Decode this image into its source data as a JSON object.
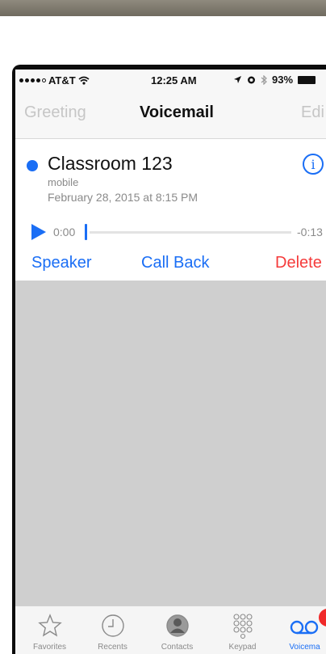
{
  "status": {
    "carrier": "AT&T",
    "time": "12:25 AM",
    "battery": "93%"
  },
  "nav": {
    "left": "Greeting",
    "title": "Voicemail",
    "right": "Edi"
  },
  "voicemail": {
    "caller": "Classroom 123",
    "type": "mobile",
    "date": "February 28, 2015 at 8:15 PM",
    "elapsed": "0:00",
    "remaining": "-0:13",
    "actions": {
      "speaker": "Speaker",
      "callback": "Call Back",
      "delete": "Delete"
    }
  },
  "tabs": [
    {
      "label": "Favorites",
      "icon": "star-icon"
    },
    {
      "label": "Recents",
      "icon": "clock-icon"
    },
    {
      "label": "Contacts",
      "icon": "contact-icon"
    },
    {
      "label": "Keypad",
      "icon": "keypad-icon"
    },
    {
      "label": "Voicema",
      "icon": "voicemail-icon"
    }
  ],
  "colors": {
    "accent": "#1a6ef5",
    "destructive": "#f53b3b",
    "badge": "#f02a2a"
  }
}
